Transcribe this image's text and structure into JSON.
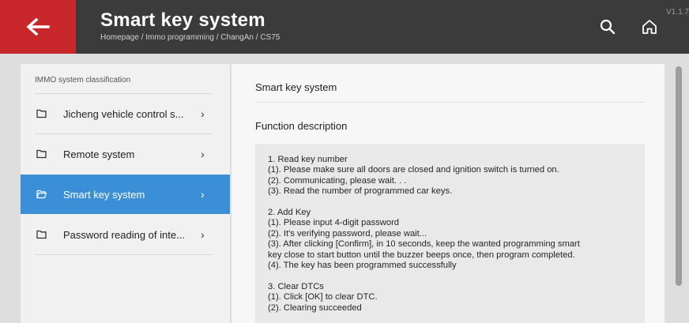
{
  "header": {
    "title": "Smart key system",
    "breadcrumb": "Homepage / Immo programming / ChangAn / CS75",
    "version": "V1.1.7"
  },
  "sidebar": {
    "heading": "IMMO system classification",
    "items": [
      {
        "label": "Jicheng vehicle control s...",
        "active": false
      },
      {
        "label": "Remote system",
        "active": false
      },
      {
        "label": "Smart key system",
        "active": true
      },
      {
        "label": "Password reading of inte...",
        "active": false
      }
    ]
  },
  "main": {
    "title": "Smart key system",
    "section_label": "Function description",
    "lines": [
      "1. Read key number",
      "(1). Please make sure all doors are closed and ignition switch is turned on.",
      "(2). Communicating, please wait. . .",
      "(3). Read the number of programmed car keys.",
      "",
      "2. Add Key",
      "(1). Please input 4-digit password",
      "(2). It's verifying password, please wait...",
      "(3). After clicking [Confirm], in 10 seconds, keep the wanted programming smart",
      "key close to start button until the buzzer beeps once, then program completed.",
      "(4). The key has been programmed successfully",
      "",
      "3. Clear DTCs",
      "(1). Click [OK] to clear DTC.",
      "(2). Clearing succeeded"
    ]
  },
  "icons": {
    "back": "back-arrow-icon",
    "search": "search-icon",
    "home": "home-icon",
    "folder": "folder-icon",
    "chevron": "chevron-right-icon"
  },
  "colors": {
    "topbar": "#3b3b3b",
    "back_button": "#c8272b",
    "active_item": "#3b8fd6",
    "background": "#dedede"
  }
}
